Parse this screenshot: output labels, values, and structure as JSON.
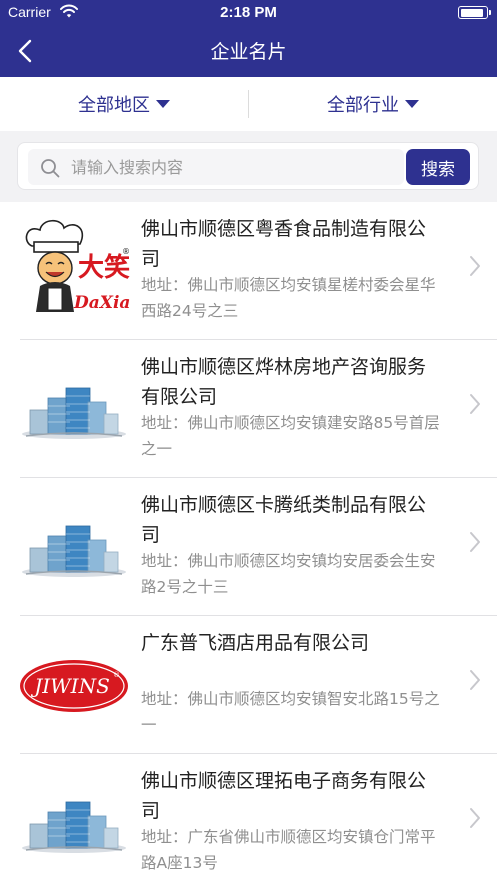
{
  "status": {
    "carrier": "Carrier",
    "time": "2:18 PM",
    "battery_level": 0.9
  },
  "nav": {
    "title": "企业名片"
  },
  "filters": {
    "region": "全部地区",
    "industry": "全部行业"
  },
  "search": {
    "placeholder": "请输入搜索内容",
    "button": "搜索"
  },
  "companies": [
    {
      "name": "佛山市顺德区粤香食品制造有限公司",
      "address": "地址：佛山市顺德区均安镇星槎村委会星华西路24号之三",
      "logo": "daxiao-chef-logo",
      "logo_text": "大笑 DaXiao"
    },
    {
      "name": "佛山市顺德区烨林房地产咨询服务有限公司",
      "address": "地址：佛山市顺德区均安镇建安路85号首层之一",
      "logo": "building-icon"
    },
    {
      "name": "佛山市顺德区卡腾纸类制品有限公司",
      "address": "地址：佛山市顺德区均安镇均安居委会生安路2号之十三",
      "logo": "building-icon"
    },
    {
      "name": "广东普飞酒店用品有限公司",
      "address": "地址：佛山市顺德区均安镇智安北路15号之一",
      "logo": "jiwins-logo",
      "logo_text": "JIWINS"
    },
    {
      "name": "佛山市顺德区理拓电子商务有限公司",
      "address": "地址：广东省佛山市顺德区均安镇仓门常平路A座13号",
      "logo": "building-icon"
    }
  ],
  "colors": {
    "primary": "#2e3190",
    "logo_red": "#d71920"
  }
}
